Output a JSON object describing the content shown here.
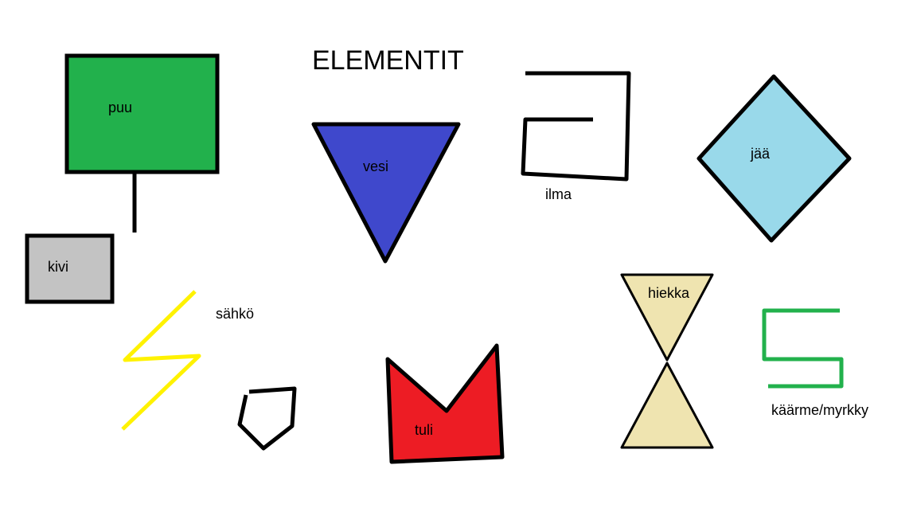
{
  "title": "ELEMENTIT",
  "elements": {
    "puu": "puu",
    "kivi": "kivi",
    "vesi": "vesi",
    "ilma": "ilma",
    "jaa": "jää",
    "sahko": "sähkö",
    "tuli": "tuli",
    "hiekka": "hiekka",
    "kaarme": "käärme/myrkky"
  },
  "colors": {
    "puu": "#22b14c",
    "kivi": "#c3c3c3",
    "vesi": "#3f48cc",
    "jaa": "#99d9ea",
    "sahko": "#fff200",
    "tuli": "#ed1c24",
    "hiekka": "#efe4b0",
    "kaarme": "#22b14c",
    "outline": "#000000"
  }
}
